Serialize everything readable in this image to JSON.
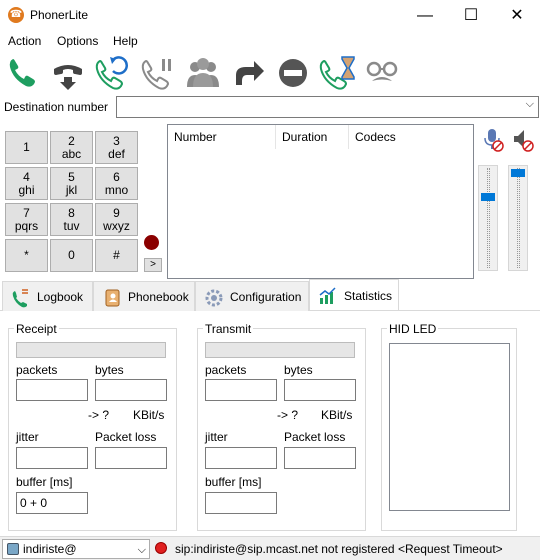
{
  "window": {
    "title": "PhonerLite",
    "minimize": "—",
    "maximize": "☐",
    "close": "✕"
  },
  "menu": [
    "Action",
    "Options",
    "Help"
  ],
  "toolbar": {
    "icons": [
      "call-icon",
      "hangup-icon",
      "redial-icon",
      "hold-icon",
      "conference-icon",
      "transfer-icon",
      "reject-icon",
      "call-waiting-icon",
      "incognito-icon"
    ],
    "colors": {
      "green": "#1e9e60",
      "gray": "#8a8a8a",
      "dark": "#444444"
    }
  },
  "destination": {
    "label": "Destination number",
    "value": ""
  },
  "keypad": [
    {
      "digit": "1",
      "letters": ""
    },
    {
      "digit": "2",
      "letters": "abc"
    },
    {
      "digit": "3",
      "letters": "def"
    },
    {
      "digit": "4",
      "letters": "ghi"
    },
    {
      "digit": "5",
      "letters": "jkl"
    },
    {
      "digit": "6",
      "letters": "mno"
    },
    {
      "digit": "7",
      "letters": "pqrs"
    },
    {
      "digit": "8",
      "letters": "tuv"
    },
    {
      "digit": "9",
      "letters": "wxyz"
    },
    {
      "digit": "*",
      "letters": ""
    },
    {
      "digit": "0",
      "letters": ""
    },
    {
      "digit": "#",
      "letters": ""
    }
  ],
  "more_button": ">",
  "calls_table": {
    "columns": [
      "Number",
      "Duration",
      "Codecs"
    ],
    "rows": []
  },
  "volume": {
    "mic_level": 0.72,
    "speaker_level": 0.97
  },
  "tabs": [
    {
      "label": "Logbook",
      "icon": "logbook-icon"
    },
    {
      "label": "Phonebook",
      "icon": "phonebook-icon"
    },
    {
      "label": "Configuration",
      "icon": "configuration-icon"
    },
    {
      "label": "Statistics",
      "icon": "statistics-icon",
      "active": true
    }
  ],
  "statistics": {
    "receipt": {
      "title": "Receipt",
      "packets_label": "packets",
      "bytes_label": "bytes",
      "packets": "",
      "bytes": "",
      "rate_arrow": "-> ?",
      "rate_unit": "KBit/s",
      "jitter_label": "jitter",
      "loss_label": "Packet loss",
      "jitter": "",
      "loss": "",
      "buffer_label": "buffer [ms]",
      "buffer": "0 + 0"
    },
    "transmit": {
      "title": "Transmit",
      "packets_label": "packets",
      "bytes_label": "bytes",
      "packets": "",
      "bytes": "",
      "rate_arrow": "-> ?",
      "rate_unit": "KBit/s",
      "jitter_label": "jitter",
      "loss_label": "Packet loss",
      "jitter": "",
      "loss": "",
      "buffer_label": "buffer [ms]",
      "buffer": ""
    },
    "hid_led": {
      "title": "HID LED"
    }
  },
  "status": {
    "account": "indiriste@",
    "message": "sip:indiriste@sip.mcast.net not registered <Request Timeout>",
    "status_color": "#e02020"
  }
}
